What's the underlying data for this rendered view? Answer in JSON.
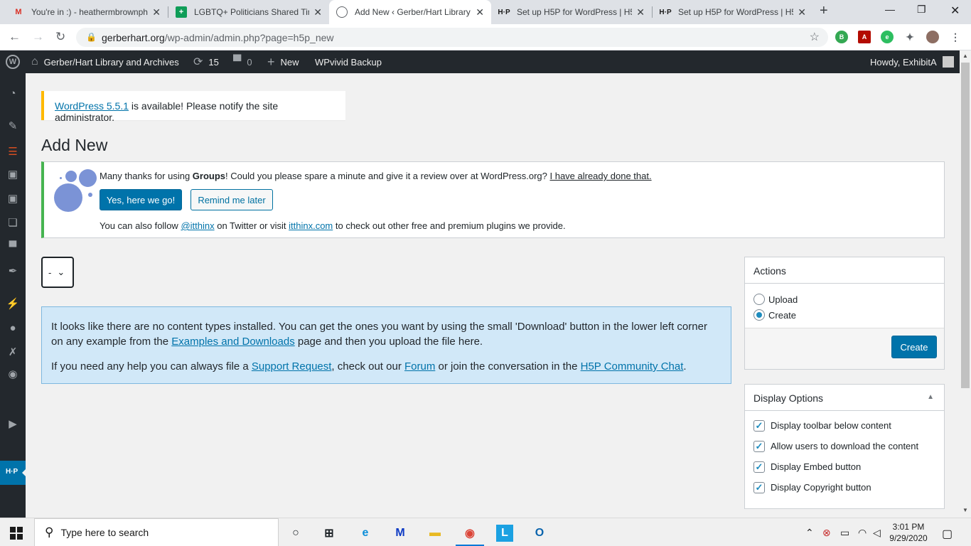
{
  "browser": {
    "tabs": [
      {
        "title": "You're in :) - heathermbrownph",
        "favicon": "gmail-icon",
        "active": false
      },
      {
        "title": "LGBTQ+ Politicians Shared Tim",
        "favicon": "sheets-icon",
        "active": false
      },
      {
        "title": "Add New ‹ Gerber/Hart Library",
        "favicon": "globe-icon",
        "active": true
      },
      {
        "title": "Set up H5P for WordPress | H5",
        "favicon": "h5p-icon",
        "active": false
      },
      {
        "title": "Set up H5P for WordPress | H5",
        "favicon": "h5p-icon",
        "active": false
      }
    ],
    "url_host": "gerberhart.org",
    "url_path": "/wp-admin/admin.php?page=h5p_new"
  },
  "adminbar": {
    "site_name": "Gerber/Hart Library and Archives",
    "updates_count": "15",
    "comments_count": "0",
    "new_label": "New",
    "wpvivid_label": "WPvivid Backup",
    "howdy": "Howdy, ExhibitA"
  },
  "update_notice": {
    "link": "WordPress 5.5.1",
    "text": " is available! Please notify the site administrator."
  },
  "page_title": "Add New",
  "groups_notice": {
    "text_before": "Many thanks for using ",
    "bold": "Groups",
    "text_after": "! Could you please spare a minute and give it a review over at WordPress.org? ",
    "done_link": "I have already done that.",
    "yes_button": "Yes, here we go!",
    "remind_button": "Remind me later",
    "follow_before": "You can also follow ",
    "twitter_link": "@itthinx",
    "follow_mid": " on Twitter or visit ",
    "site_link": "itthinx.com",
    "follow_after": " to check out other free and premium plugins we provide."
  },
  "content_type_select": {
    "value": "-"
  },
  "info_box": {
    "p1_before": "It looks like there are no content types installed. You can get the ones you want by using the small 'Download' button in the lower left corner on any example from the ",
    "p1_link": "Examples and Downloads",
    "p1_after": " page and then you upload the file here.",
    "p2_before": "If you need any help you can always file a ",
    "p2_link1": "Support Request",
    "p2_mid1": ", check out our ",
    "p2_link2": "Forum",
    "p2_mid2": " or join the conversation in the ",
    "p2_link3": "H5P Community Chat",
    "p2_after": "."
  },
  "actions_box": {
    "title": "Actions",
    "options": [
      {
        "label": "Upload",
        "selected": false
      },
      {
        "label": "Create",
        "selected": true
      }
    ],
    "create_button": "Create"
  },
  "display_options": {
    "title": "Display Options",
    "options": [
      {
        "label": "Display toolbar below content",
        "checked": true
      },
      {
        "label": "Allow users to download the content",
        "checked": true
      },
      {
        "label": "Display Embed button",
        "checked": true
      },
      {
        "label": "Display Copyright button",
        "checked": true
      }
    ]
  },
  "taskbar": {
    "search_placeholder": "Type here to search",
    "time": "3:01 PM",
    "date": "9/29/2020"
  },
  "colors": {
    "wp_blue": "#0073aa",
    "admin_bar": "#23282d",
    "notice_warning": "#ffb900",
    "notice_success": "#46b450",
    "info_bg": "#d1e8f8"
  }
}
